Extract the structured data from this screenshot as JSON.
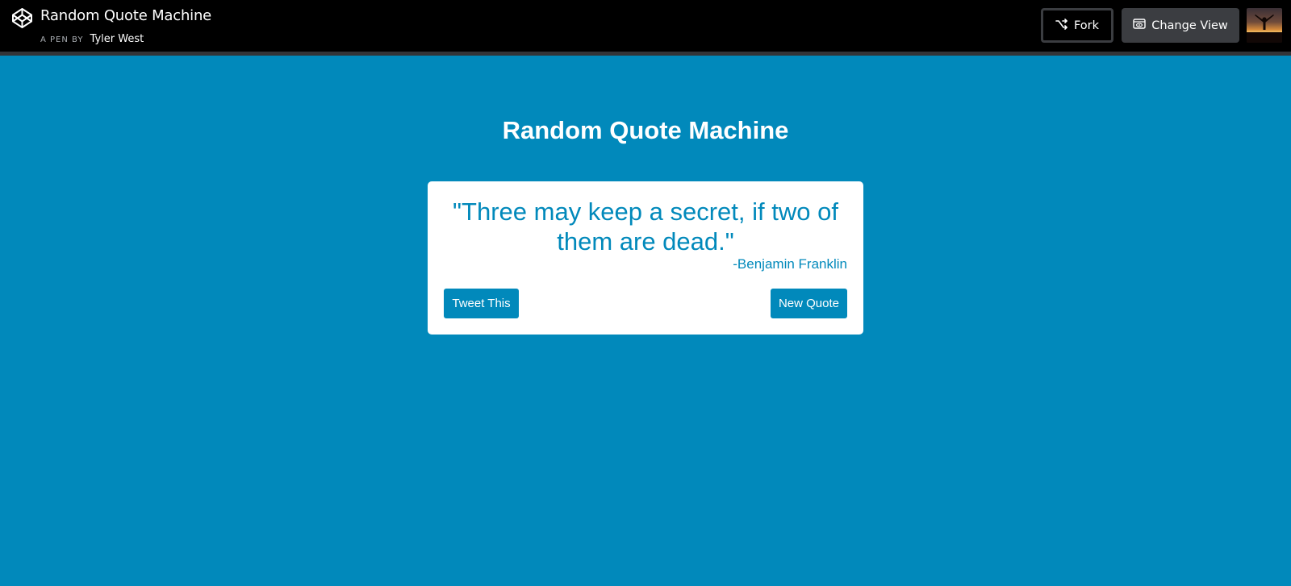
{
  "header": {
    "pen_title": "Random Quote Machine",
    "by_label": "A PEN BY",
    "author": "Tyler West",
    "fork_label": "Fork",
    "change_view_label": "Change View",
    "logo_icon": "codepen-logo-icon",
    "fork_icon": "fork-icon",
    "change_view_icon": "eye-window-icon"
  },
  "page": {
    "title": "Random Quote Machine"
  },
  "quote": {
    "text": "\"Three may keep a secret, if two of them are dead.\"",
    "author": "-Benjamin Franklin",
    "tweet_label": "Tweet This",
    "new_quote_label": "New Quote"
  },
  "colors": {
    "background": "#0189bb",
    "topbar": "#000000",
    "card": "#ffffff",
    "accent": "#0189bb"
  }
}
